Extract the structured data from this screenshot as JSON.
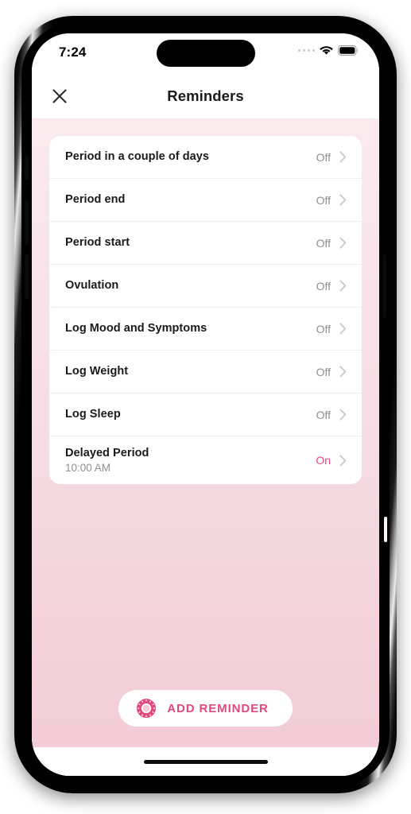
{
  "status_bar": {
    "time": "7:24",
    "signal_icon": "signal-dots-icon",
    "wifi_icon": "wifi-icon",
    "battery_icon": "battery-full-icon"
  },
  "nav": {
    "close_icon": "close-icon",
    "title": "Reminders"
  },
  "colors": {
    "accent_pink": "#e8447f",
    "button_text_pink": "#e0497e",
    "status_off_gray": "#8e8e93",
    "background_top": "#faeaee",
    "background_bottom": "#f2ccd6",
    "card_white": "#ffffff"
  },
  "reminders": [
    {
      "label": "Period in a couple of days",
      "subtitle": "",
      "status": "Off",
      "state": "off"
    },
    {
      "label": "Period end",
      "subtitle": "",
      "status": "Off",
      "state": "off"
    },
    {
      "label": "Period start",
      "subtitle": "",
      "status": "Off",
      "state": "off"
    },
    {
      "label": "Ovulation",
      "subtitle": "",
      "status": "Off",
      "state": "off"
    },
    {
      "label": "Log Mood and Symptoms",
      "subtitle": "",
      "status": "Off",
      "state": "off"
    },
    {
      "label": "Log Weight",
      "subtitle": "",
      "status": "Off",
      "state": "off"
    },
    {
      "label": "Log Sleep",
      "subtitle": "",
      "status": "Off",
      "state": "off"
    },
    {
      "label": "Delayed Period",
      "subtitle": "10:00 AM",
      "status": "On",
      "state": "on"
    }
  ],
  "add_reminder": {
    "label": "ADD REMINDER",
    "icon": "clock-dial-icon"
  }
}
